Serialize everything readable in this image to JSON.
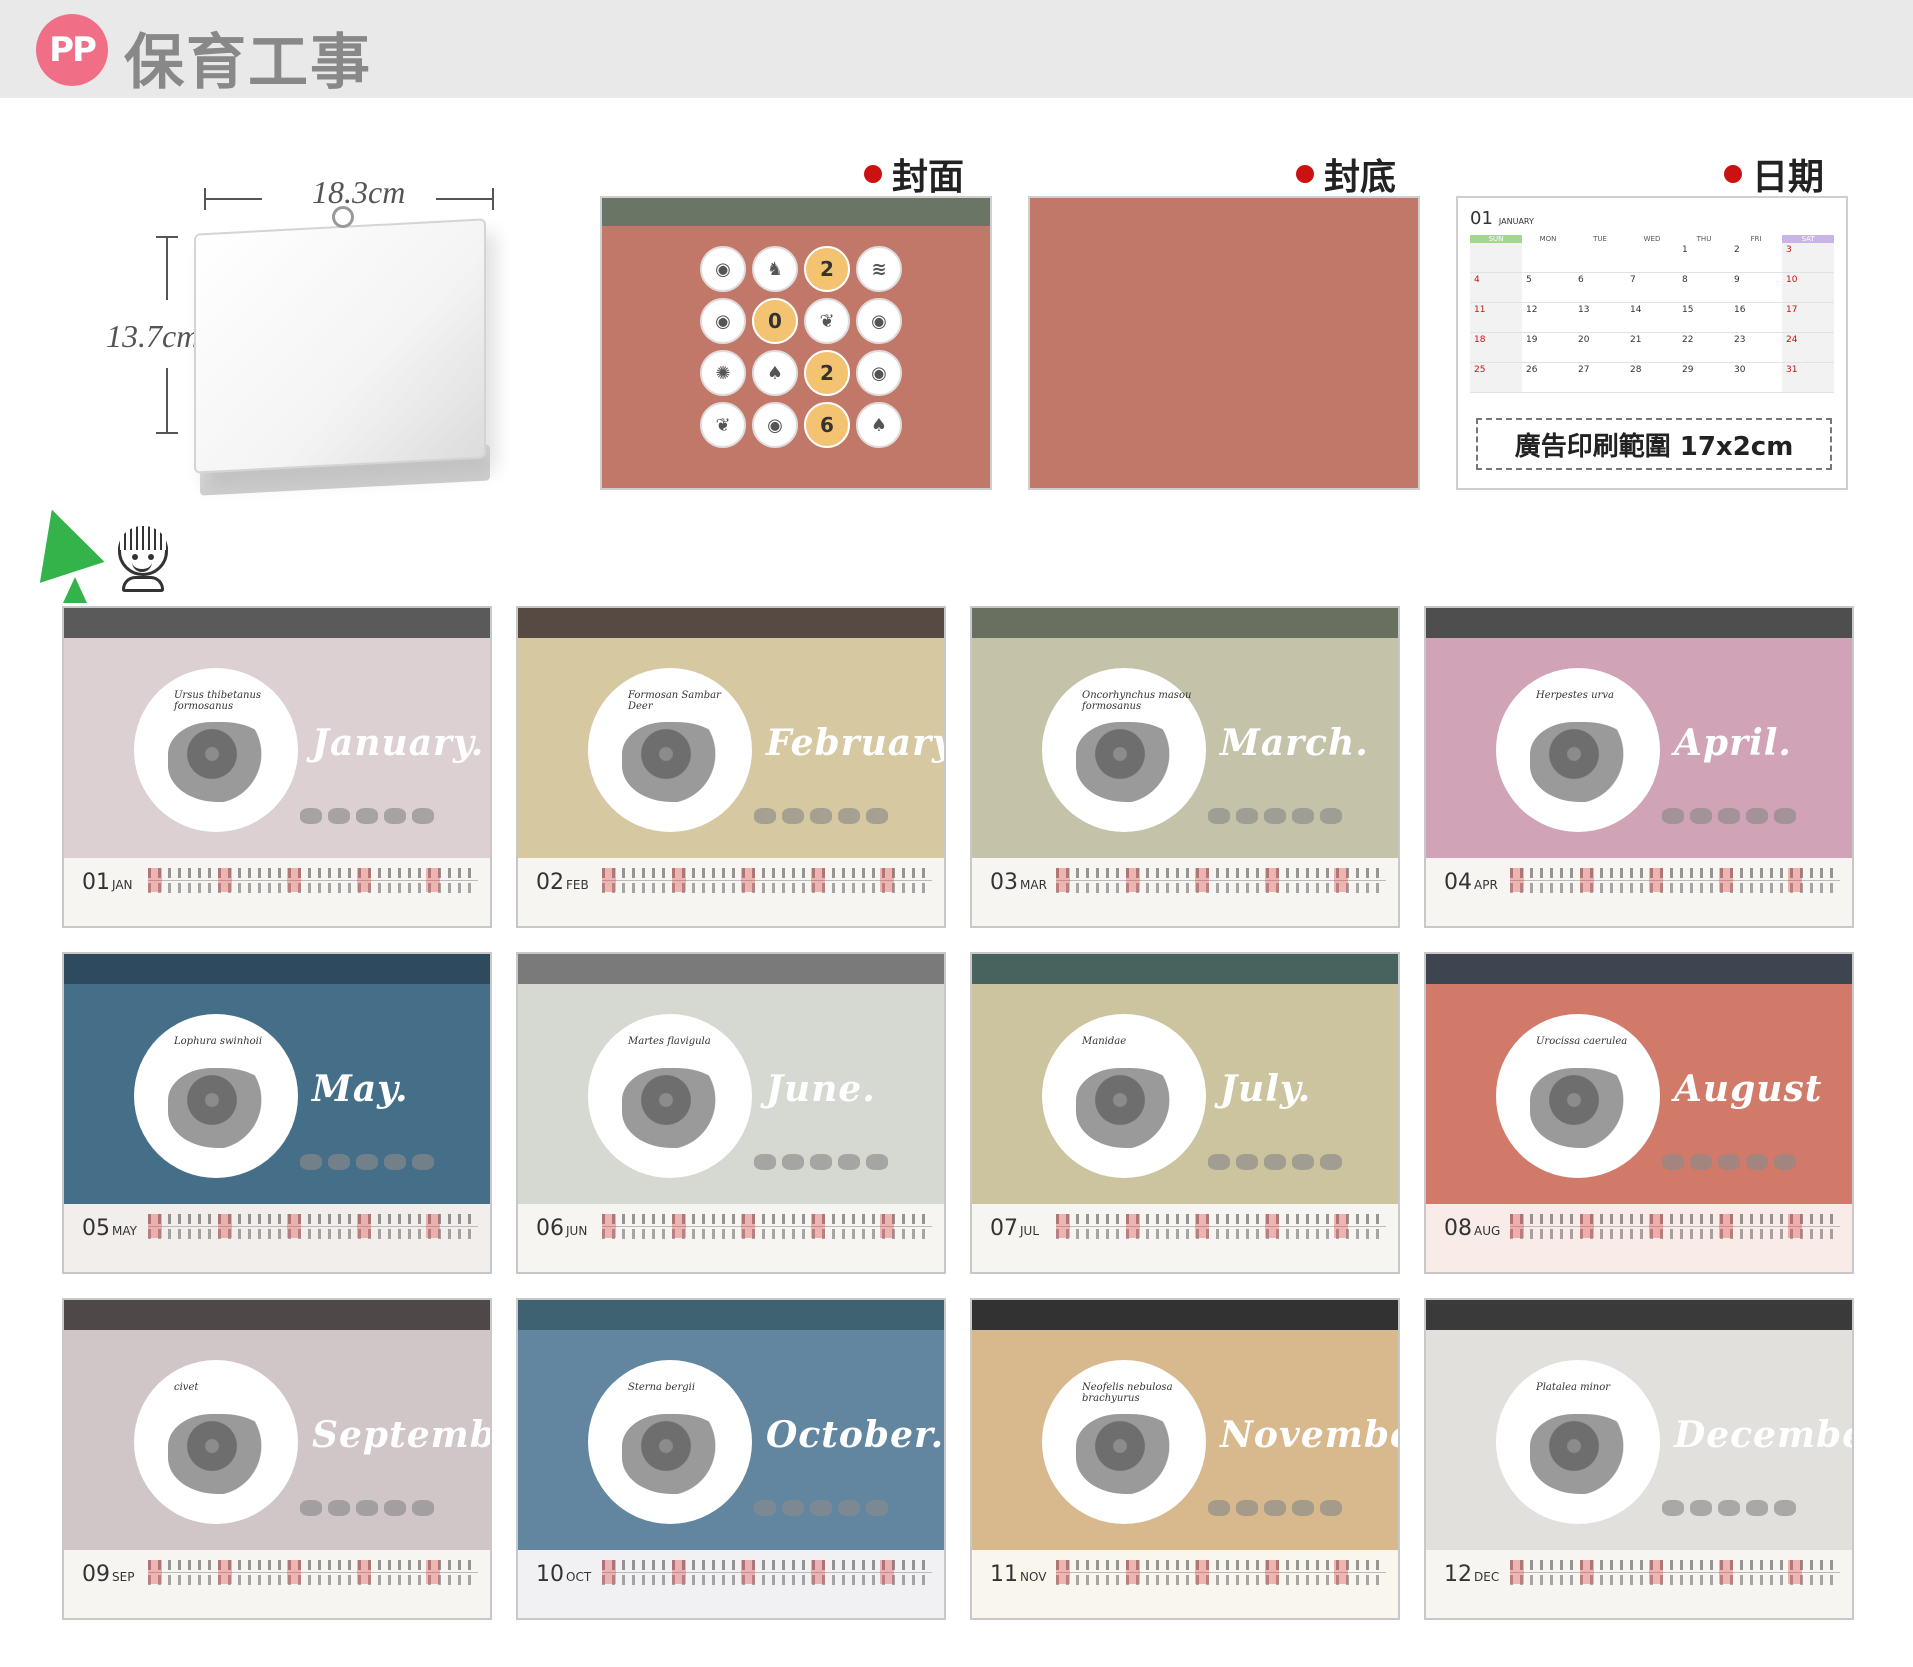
{
  "header": {
    "logo": "PP",
    "brand": "保育工事"
  },
  "dimensions": {
    "width": "18.3cm",
    "height": "13.7cm"
  },
  "previews": {
    "cover_label": "封面",
    "back_label": "封底",
    "date_label": "日期",
    "cover_numbers": [
      "2",
      "0",
      "2",
      "6"
    ],
    "date_page": {
      "month_num": "01",
      "month_name": "JANUARY",
      "weekdays": [
        "SUN",
        "MON",
        "TUE",
        "WED",
        "THU",
        "FRI",
        "SAT"
      ],
      "days": [
        "",
        "",
        "",
        "",
        "1",
        "2",
        "3",
        "4",
        "5",
        "6",
        "7",
        "8",
        "9",
        "10",
        "11",
        "12",
        "13",
        "14",
        "15",
        "16",
        "17",
        "18",
        "19",
        "20",
        "21",
        "22",
        "23",
        "24",
        "25",
        "26",
        "27",
        "28",
        "29",
        "30",
        "31"
      ],
      "ad_text": "廣告印刷範圍 17x2cm"
    }
  },
  "months": [
    {
      "num": "01",
      "abbr": "JAN",
      "name": "January.",
      "latin": "Ursus thibetanus formosanus"
    },
    {
      "num": "02",
      "abbr": "FEB",
      "name": "February.",
      "latin": "Formosan Sambar Deer"
    },
    {
      "num": "03",
      "abbr": "MAR",
      "name": "March.",
      "latin": "Oncorhynchus masou formosanus"
    },
    {
      "num": "04",
      "abbr": "APR",
      "name": "April.",
      "latin": "Herpestes urva"
    },
    {
      "num": "05",
      "abbr": "MAY",
      "name": "May.",
      "latin": "Lophura swinhoii"
    },
    {
      "num": "06",
      "abbr": "JUN",
      "name": "June.",
      "latin": "Martes flavigula"
    },
    {
      "num": "07",
      "abbr": "JUL",
      "name": "July.",
      "latin": "Manidae"
    },
    {
      "num": "08",
      "abbr": "AUG",
      "name": "August",
      "latin": "Urocissa caerulea"
    },
    {
      "num": "09",
      "abbr": "SEP",
      "name": "September.",
      "latin": "civet"
    },
    {
      "num": "10",
      "abbr": "OCT",
      "name": "October.",
      "latin": "Sterna bergii"
    },
    {
      "num": "11",
      "abbr": "NOV",
      "name": "November.",
      "latin": "Neofelis nebulosa brachyurus"
    },
    {
      "num": "12",
      "abbr": "DEC",
      "name": "December.",
      "latin": "Platalea minor"
    }
  ],
  "colors": {
    "cover": "#c27868",
    "cover_band": "#6a7565",
    "month_bodies": [
      "#dcd0d2",
      "#d6c9a2",
      "#c4c2a8",
      "#d0a4b6",
      "#456e88",
      "#d6d8d2",
      "#ccc49e",
      "#d27a6a",
      "#d0c6c8",
      "#6286a0",
      "#d8b98e",
      "#e2e0dc"
    ],
    "month_bands": [
      "#5a5a5a",
      "#574a42",
      "#6a7060",
      "#4e4e4e",
      "#2e4a5e",
      "#7a7a7a",
      "#48625e",
      "#3e4450",
      "#4e4848",
      "#3e6272",
      "#323232",
      "#3a3a3a"
    ],
    "month_feet": [
      "#f7f5f2",
      "#f7f5f2",
      "#f7f5f2",
      "#f7f5f2",
      "#f1eeec",
      "#f7f5f2",
      "#f7f5f2",
      "#f9ece8",
      "#f7f5f2",
      "#f1f1f4",
      "#f9f6ee",
      "#f7f5f2"
    ]
  },
  "icons": [
    "pencil-icon",
    "girl-icon"
  ]
}
